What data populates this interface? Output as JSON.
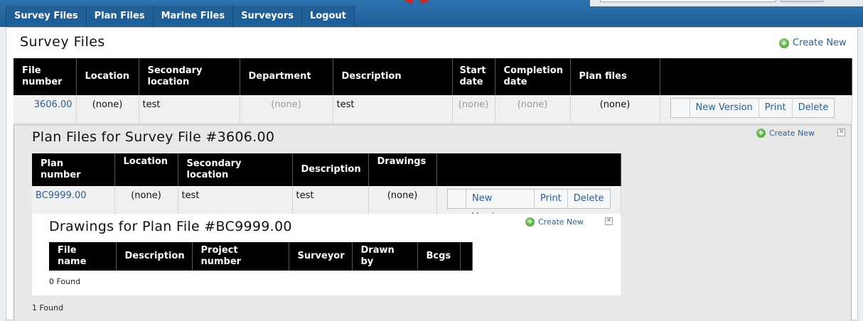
{
  "nav": {
    "items": [
      "Survey Files",
      "Plan Files",
      "Marine Files",
      "Surveyors",
      "Logout"
    ]
  },
  "survey": {
    "title": "Survey Files",
    "create_new": "Create New",
    "headers": [
      "File number",
      "Location",
      "Secondary location",
      "Department",
      "Description",
      "Start date",
      "Completion date",
      "Plan files",
      ""
    ],
    "row": {
      "file_number": "3606.00",
      "location": "(none)",
      "secondary_location": "test",
      "department": "(none)",
      "description": "test",
      "start_date": "(none)",
      "completion_date": "(none)",
      "plan_files": "(none)"
    },
    "actions": {
      "new_version": "New Version",
      "print": "Print",
      "delete": "Delete"
    },
    "found": "1 Found"
  },
  "plan": {
    "title": "Plan Files for Survey File #3606.00",
    "create_new": "Create New",
    "headers": [
      "Plan number",
      "Location",
      "Secondary location",
      "Description",
      "Drawings",
      ""
    ],
    "row": {
      "plan_number": "BC9999.00",
      "location": "(none)",
      "secondary_location": "test",
      "description": "test",
      "drawings": "(none)"
    },
    "actions": {
      "new_version": "New Version",
      "print": "Print",
      "delete": "Delete"
    }
  },
  "drawings": {
    "title": "Drawings for Plan File #BC9999.00",
    "create_new": "Create New",
    "headers": [
      "File name",
      "Description",
      "Project number",
      "Surveyor",
      "Drawn by",
      "Bcgs",
      ""
    ],
    "found": "0 Found"
  },
  "icons": {
    "create": "plus-circle-icon",
    "close": "close-icon"
  },
  "colors": {
    "nav_bg": "#1f5e97",
    "link": "#2f5f8f",
    "header_bg": "#000000",
    "create_icon": "#3f9a2c"
  }
}
